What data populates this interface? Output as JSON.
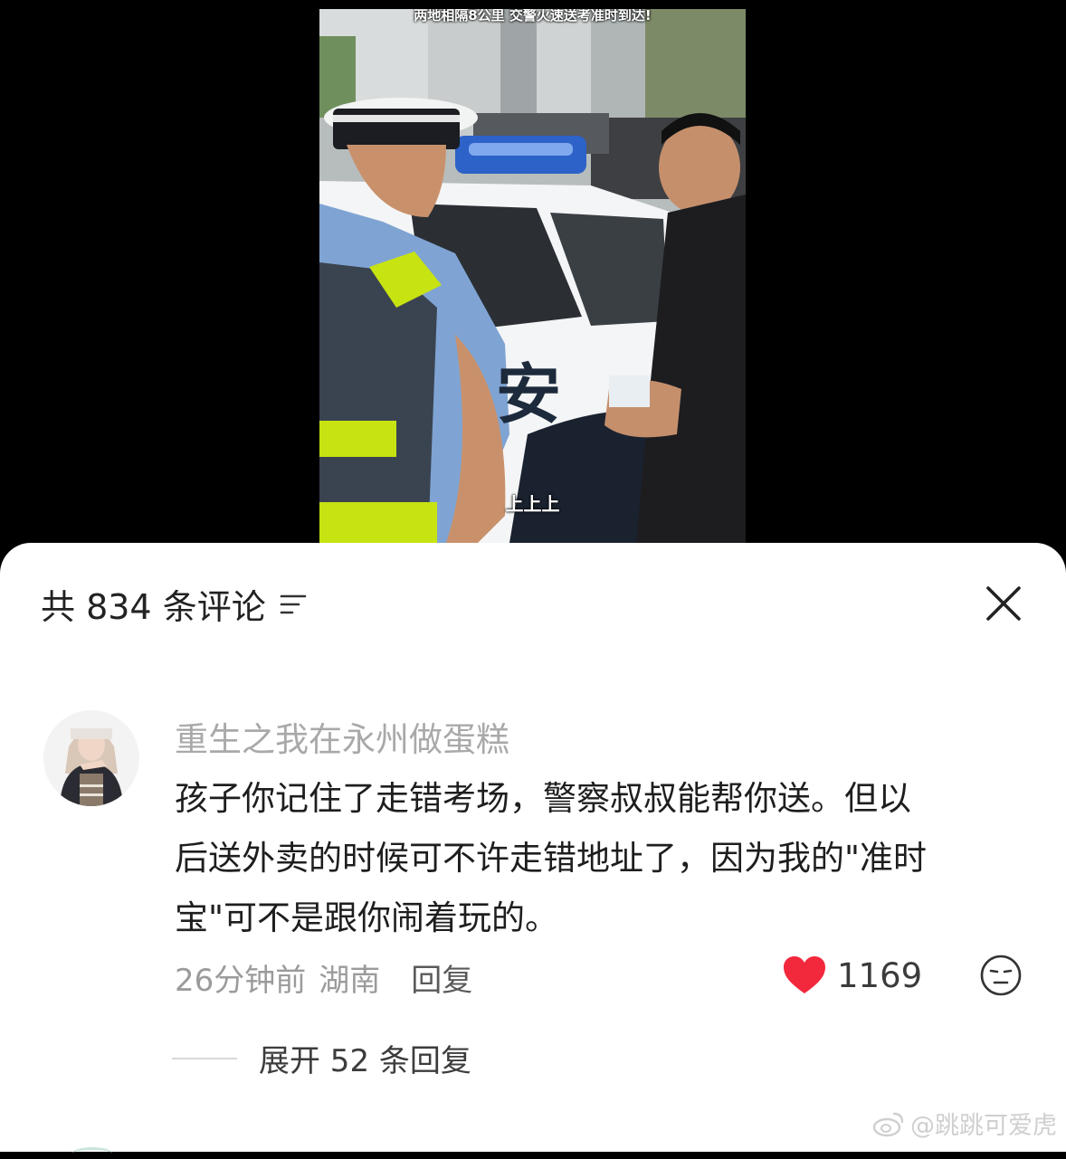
{
  "video": {
    "title": "两地相隔8公里 交警火速送考准时到达!",
    "subtitle": "上上上",
    "car_text": "安"
  },
  "comments_panel": {
    "count_label": "共 834 条评论",
    "filter_icon": "filter-icon",
    "close_icon": "close-icon"
  },
  "comment": {
    "username": "重生之我在永州做蛋糕",
    "text_lines": [
      "孩子你记住了走错考场，警察叔叔能帮你送。但以",
      "后送外卖的时候可不许走错地址了，因为我的\"准时",
      "宝\"可不是跟你闹着玩的。"
    ],
    "time": "26分钟前",
    "location": "湖南",
    "reply_label": "回复",
    "like_count": "1169",
    "like_color": "#f2283c",
    "expand_label": "展开 52 条回复"
  },
  "watermark": "@跳跳可爱虎"
}
